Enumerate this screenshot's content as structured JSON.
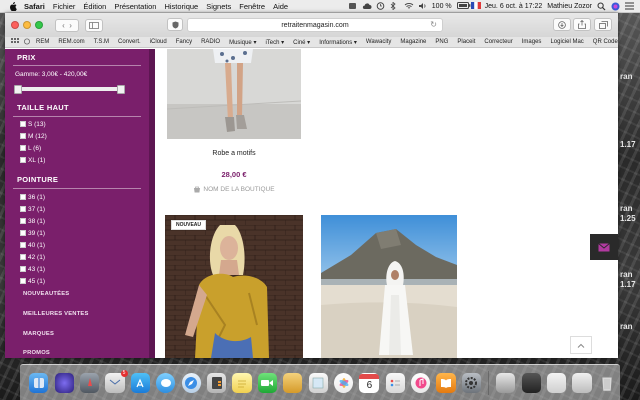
{
  "menubar": {
    "app": "Safari",
    "items": [
      "Fichier",
      "Édition",
      "Présentation",
      "Historique",
      "Signets",
      "Fenêtre",
      "Aide"
    ],
    "battery": "100 %",
    "datetime": "Jeu. 6 oct. à 17:22",
    "user": "Mathieu Zozor"
  },
  "safari": {
    "url": "retraitenmagasin.com",
    "bookmarks": [
      "REM",
      "REM.com",
      "T.S.M",
      "Convert.",
      "iCloud",
      "Fancy",
      "RADIO",
      "Musique",
      "iTech",
      "Ciné",
      "Informations",
      "Wawacity",
      "Magazine",
      "PNG",
      "Placeit",
      "Correcteur",
      "Images",
      "Logiciel Mac",
      "QR Code"
    ]
  },
  "sidebar": {
    "price_title": "PRIX",
    "price_range": "Gamme: 3,00€ - 420,00€",
    "price_slider": {
      "min": 3,
      "max": 420,
      "low": 3,
      "high": 420
    },
    "size_title": "TAILLE HAUT",
    "sizes": [
      "S (13)",
      "M (12)",
      "L (6)",
      "XL (1)"
    ],
    "shoe_title": "POINTURE",
    "shoe_sizes": [
      "36 (1)",
      "37 (1)",
      "38 (1)",
      "39 (1)",
      "40 (1)",
      "42 (1)",
      "43 (1)",
      "45 (1)"
    ],
    "links": [
      "NOUVEAUTÉES",
      "MEILLEURES VENTES",
      "MARQUES",
      "PROMOS"
    ]
  },
  "product": {
    "name": "Robe a motifs",
    "price": "28,00 €",
    "shop": "NOM DE LA BOUTIQUE"
  },
  "badge_new": "NOUVEAU",
  "wallpaper_text": [
    "ran",
    "1.17",
    "ran",
    "1.25",
    "ran",
    "1.17",
    "ran"
  ],
  "dock": {
    "mail_badge": "5",
    "calendar_day": "6"
  },
  "colors": {
    "sidebar": "#7a1f6b",
    "price": "#7a1f6b"
  }
}
